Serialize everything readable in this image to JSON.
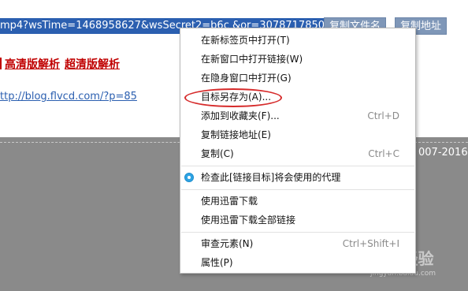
{
  "page": {
    "url_text": "mp4?wsTime=1468958627&wsSecret2=b6c      &or=3078717850",
    "copy_filename_label": "复制文件名",
    "copy_address_label": "复制地址",
    "hd_link_1": "高清版解析",
    "hd_link_2": "超清版解析",
    "blog_link": "ttp://blog.flvcd.com/?p=85",
    "year_text": "007-2016",
    "watermark_text": "Bai度 经验",
    "watermark_sub": "jingyan.baidu.com"
  },
  "context_menu": {
    "items": [
      {
        "label": "在新标签页中打开(T)"
      },
      {
        "label": "在新窗口中打开链接(W)"
      },
      {
        "label": "在隐身窗口中打开(G)"
      },
      {
        "label": "目标另存为(A)..."
      },
      {
        "label": "添加到收藏夹(F)...",
        "shortcut": "Ctrl+D"
      },
      {
        "label": "复制链接地址(E)"
      },
      {
        "label": "复制(C)",
        "shortcut": "Ctrl+C"
      },
      {
        "label": "检查此[链接目标]将会使用的代理"
      },
      {
        "label": "使用迅雷下载"
      },
      {
        "label": "使用迅雷下载全部链接"
      },
      {
        "label": "审查元素(N)",
        "shortcut": "Ctrl+Shift+I"
      },
      {
        "label": "属性(P)"
      }
    ]
  },
  "colors": {
    "selection_blue": "#2b5fb0",
    "button_bg": "#7f97b8",
    "link_red": "#c00000",
    "footer_gray": "#8a8a8a",
    "highlight_red": "#d62b2b",
    "radio_blue": "#2ea3e3"
  },
  "icons": {
    "proxy_item_icon": "radio-dot-icon"
  }
}
